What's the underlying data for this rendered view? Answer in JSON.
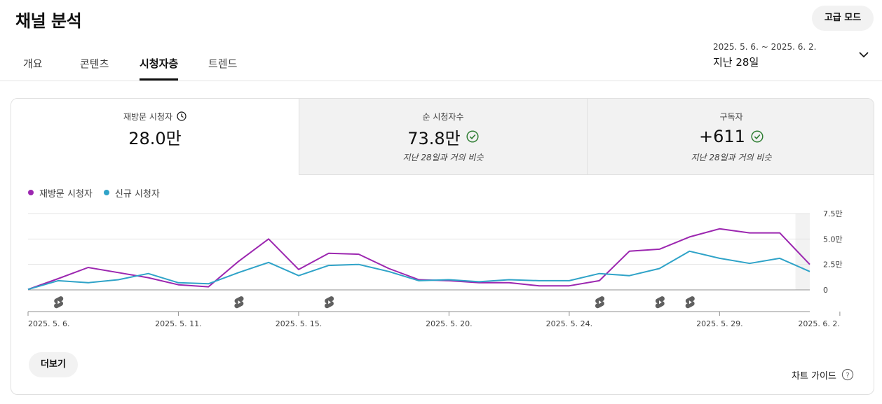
{
  "header": {
    "title": "채널 분석",
    "advanced_mode": "고급 모드"
  },
  "tabs": [
    {
      "label": "개요",
      "active": false
    },
    {
      "label": "콘텐츠",
      "active": false
    },
    {
      "label": "시청자층",
      "active": true
    },
    {
      "label": "트렌드",
      "active": false
    }
  ],
  "date_range": {
    "dates": "2025. 5. 6. ~ 2025. 6. 2.",
    "period": "지난 28일",
    "icon": "chevron-down-icon"
  },
  "metrics": [
    {
      "label": "재방문 시청자",
      "value": "28.0만",
      "note": "",
      "icon": "clock-icon"
    },
    {
      "label": "순 시청자수",
      "value": "73.8만",
      "note": "지난 28일과 거의 비슷",
      "icon": "check-circle-icon"
    },
    {
      "label": "구독자",
      "value": "+611",
      "note": "지난 28일과 거의 비슷",
      "icon": "check-circle-icon"
    }
  ],
  "colors": {
    "returning": "#9c27b0",
    "new": "#2fa3c8",
    "check": "#2e7d32"
  },
  "chart_data": {
    "type": "line",
    "legend": [
      "재방문 시청자",
      "신규 시청자"
    ],
    "series": [
      {
        "name": "재방문 시청자",
        "values": [
          0.05,
          1.1,
          2.2,
          1.7,
          1.2,
          0.5,
          0.3,
          2.8,
          5.0,
          2.0,
          3.6,
          3.5,
          2.1,
          1.0,
          0.9,
          0.7,
          0.7,
          0.4,
          0.4,
          0.9,
          3.8,
          4.0,
          5.2,
          6.0,
          5.6,
          5.6,
          2.5
        ]
      },
      {
        "name": "신규 시청자",
        "values": [
          0.05,
          0.9,
          0.7,
          1.0,
          1.6,
          0.7,
          0.6,
          1.7,
          2.7,
          1.4,
          2.4,
          2.5,
          1.8,
          0.9,
          1.0,
          0.8,
          1.0,
          0.9,
          0.9,
          1.6,
          1.4,
          2.1,
          3.8,
          3.1,
          2.6,
          3.1,
          1.8
        ]
      }
    ],
    "y_ticks": [
      "7.5만",
      "5.0만",
      "2.5만",
      "0"
    ],
    "ylim": [
      0,
      7.5
    ],
    "x_tick_labels": [
      "2025. 5. 6.",
      "2025. 5. 11.",
      "2025. 5. 15.",
      "2025. 5. 20.",
      "2025. 5. 24.",
      "2025. 5. 29.",
      "2025. 6. 2."
    ],
    "x_tick_positions": [
      0,
      5,
      9,
      14,
      18,
      23,
      27
    ],
    "shorts_marker_days": [
      1,
      7,
      10,
      19,
      21,
      22
    ],
    "shorts_icon": "shorts-icon",
    "partial_day_shaded": true,
    "grid": true
  },
  "footer": {
    "more": "더보기",
    "chart_guide": "차트 가이드",
    "help_icon": "help-circle-icon"
  }
}
